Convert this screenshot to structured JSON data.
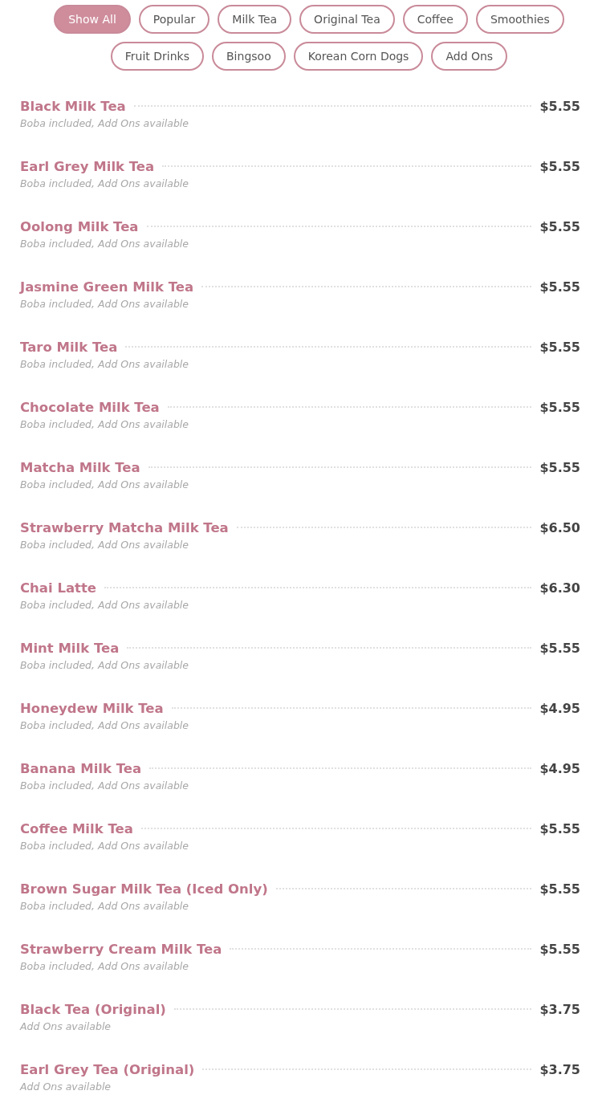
{
  "filters": [
    {
      "label": "Show All",
      "selected": true
    },
    {
      "label": "Popular",
      "selected": false
    },
    {
      "label": "Milk Tea",
      "selected": false
    },
    {
      "label": "Original Tea",
      "selected": false
    },
    {
      "label": "Coffee",
      "selected": false
    },
    {
      "label": "Smoothies",
      "selected": false
    },
    {
      "label": "Fruit Drinks",
      "selected": false
    },
    {
      "label": "Bingsoo",
      "selected": false
    },
    {
      "label": "Korean Corn Dogs",
      "selected": false
    },
    {
      "label": "Add Ons",
      "selected": false
    }
  ],
  "menu_items": [
    {
      "name": "Black Milk Tea",
      "price": "$5.55",
      "note": "Boba included, Add Ons available"
    },
    {
      "name": "Earl Grey Milk Tea",
      "price": "$5.55",
      "note": "Boba included, Add Ons available"
    },
    {
      "name": "Oolong Milk Tea",
      "price": "$5.55",
      "note": "Boba included, Add Ons available"
    },
    {
      "name": "Jasmine Green Milk Tea",
      "price": "$5.55",
      "note": "Boba included, Add Ons available"
    },
    {
      "name": "Taro Milk Tea",
      "price": "$5.55",
      "note": "Boba included, Add Ons available"
    },
    {
      "name": "Chocolate Milk Tea",
      "price": "$5.55",
      "note": "Boba included, Add Ons available"
    },
    {
      "name": "Matcha Milk Tea",
      "price": "$5.55",
      "note": "Boba included, Add Ons available"
    },
    {
      "name": "Strawberry Matcha Milk Tea",
      "price": "$6.50",
      "note": "Boba included, Add Ons available"
    },
    {
      "name": "Chai Latte",
      "price": "$6.30",
      "note": "Boba included, Add Ons available"
    },
    {
      "name": "Mint Milk Tea",
      "price": "$5.55",
      "note": "Boba included, Add Ons available"
    },
    {
      "name": "Honeydew Milk Tea",
      "price": "$4.95",
      "note": "Boba included, Add Ons available"
    },
    {
      "name": "Banana Milk Tea",
      "price": "$4.95",
      "note": "Boba included, Add Ons available"
    },
    {
      "name": "Coffee Milk Tea",
      "price": "$5.55",
      "note": "Boba included, Add Ons available"
    },
    {
      "name": "Brown Sugar Milk Tea (Iced Only)",
      "price": "$5.55",
      "note": "Boba included, Add Ons available"
    },
    {
      "name": "Strawberry Cream Milk Tea",
      "price": "$5.55",
      "note": "Boba included, Add Ons available"
    },
    {
      "name": "Black Tea (Original)",
      "price": "$3.75",
      "note": "Add Ons available"
    },
    {
      "name": "Earl Grey Tea (Original)",
      "price": "$3.75",
      "note": "Add Ons available"
    }
  ]
}
